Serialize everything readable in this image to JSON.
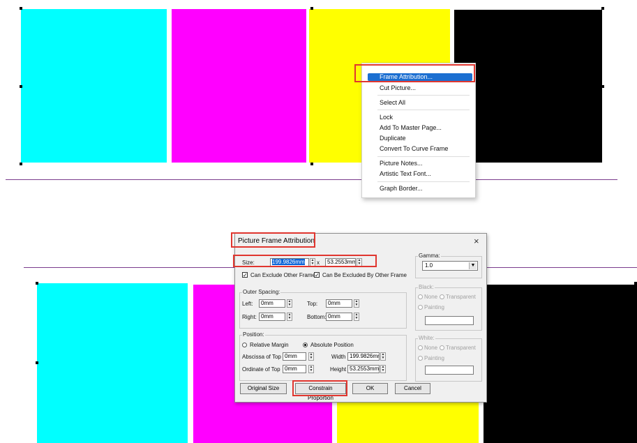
{
  "colors": {
    "cyan": "#00ffff",
    "magenta": "#ff00ff",
    "yellow": "#ffff00",
    "black": "#000000",
    "highlight": "#e0362f",
    "menu_selection": "#1c6fd1",
    "guide_line": "#7a3c8c"
  },
  "context_menu": {
    "items": [
      "Frame Attribution...",
      "Cut Picture...",
      "Select All",
      "Lock",
      "Add To Master Page...",
      "Duplicate",
      "Convert To Curve Frame",
      "Picture Notes...",
      "Artistic Text Font...",
      "Graph Border..."
    ]
  },
  "dialog": {
    "title": "Picture Frame Attribution",
    "close_icon": "×",
    "size": {
      "label": "Size:",
      "width_value": "199.9826mm",
      "separator": "x",
      "height_value": "53.2553mm"
    },
    "exclude_checkbox": "Can Exclude Other Frame",
    "excluded_checkbox": "Can Be Excluded By Other Frame",
    "outer_spacing": {
      "title": "Outer Spacing:",
      "left_label": "Left:",
      "left_value": "0mm",
      "top_label": "Top:",
      "top_value": "0mm",
      "right_label": "Right:",
      "right_value": "0mm",
      "bottom_label": "Bottom:",
      "bottom_value": "0mm"
    },
    "position": {
      "title": "Position:",
      "relative_margin": "Relative Margin",
      "absolute_position": "Absolute Position",
      "abscissa_label": "Abscissa of Top",
      "abscissa_value": "0mm",
      "ordinate_label": "Ordinate of Top",
      "ordinate_value": "0mm",
      "width_label": "Width",
      "width_value": "199.9826mr",
      "height_label": "Height",
      "height_value": "53.2553mm"
    },
    "gamma": {
      "title": "Gamma:",
      "value": "1.0"
    },
    "black": {
      "title": "Black:",
      "none": "None",
      "transparent": "Transparent",
      "painting": "Painting"
    },
    "white": {
      "title": "White:",
      "none": "None",
      "transparent": "Transparent",
      "painting": "Painting"
    },
    "buttons": {
      "original_size": "Original Size",
      "constrain_proportion": "Constrain Proportion",
      "ok": "OK",
      "cancel": "Cancel"
    }
  }
}
